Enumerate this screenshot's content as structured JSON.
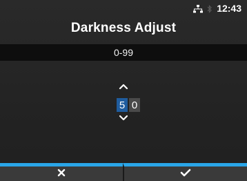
{
  "status_bar": {
    "network_icon": "network-icon",
    "bluetooth_icon": "bluetooth-icon",
    "time": "12:43"
  },
  "screen": {
    "title": "Darkness Adjust",
    "range": "0-99"
  },
  "value_editor": {
    "digits": [
      "5",
      "0"
    ],
    "selected_digit_index": 0,
    "up_icon": "chevron-up-icon",
    "down_icon": "chevron-down-icon"
  },
  "softkeys": {
    "cancel_icon": "close-icon",
    "confirm_icon": "checkmark-icon",
    "accent_color": "#2aa6e8"
  },
  "colors": {
    "selected_digit_bg": "#1f5c9e",
    "unselected_digit_bg": "#4a4a4a",
    "range_bar_bg": "#0e0e0e"
  }
}
